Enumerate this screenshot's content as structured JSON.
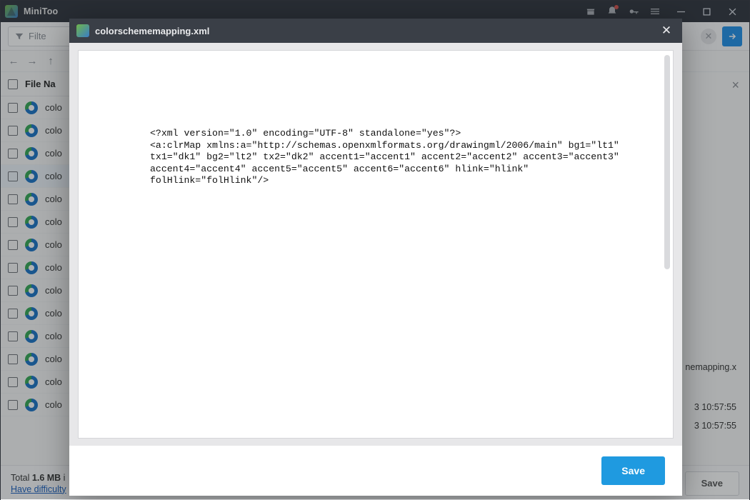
{
  "titlebar": {
    "app_name": "MiniToo"
  },
  "toolbar": {
    "filter_placeholder": "Filte"
  },
  "columns": {
    "filename": "File Na"
  },
  "rows": [
    {
      "name": "colo"
    },
    {
      "name": "colo"
    },
    {
      "name": "colo"
    },
    {
      "name": "colo"
    },
    {
      "name": "colo"
    },
    {
      "name": "colo"
    },
    {
      "name": "colo"
    },
    {
      "name": "colo"
    },
    {
      "name": "colo"
    },
    {
      "name": "colo"
    },
    {
      "name": "colo"
    },
    {
      "name": "colo"
    },
    {
      "name": "colo"
    },
    {
      "name": "colo"
    }
  ],
  "selected_index": 3,
  "rightpane": {
    "filename_tail": "nemapping.x",
    "time1": "3 10:57:55",
    "time2": "3 10:57:55"
  },
  "footer": {
    "total_prefix": "Total ",
    "total_bold": "1.6 MB",
    "total_suffix": " i",
    "link": "Have difficulty",
    "save": "Save"
  },
  "modal": {
    "title": "colorschememapping.xml",
    "save": "Save",
    "xml": "<?xml version=\"1.0\" encoding=\"UTF-8\" standalone=\"yes\"?>\n<a:clrMap xmlns:a=\"http://schemas.openxmlformats.org/drawingml/2006/main\" bg1=\"lt1\" tx1=\"dk1\" bg2=\"lt2\" tx2=\"dk2\" accent1=\"accent1\" accent2=\"accent2\" accent3=\"accent3\" accent4=\"accent4\" accent5=\"accent5\" accent6=\"accent6\" hlink=\"hlink\" folHlink=\"folHlink\"/>"
  }
}
